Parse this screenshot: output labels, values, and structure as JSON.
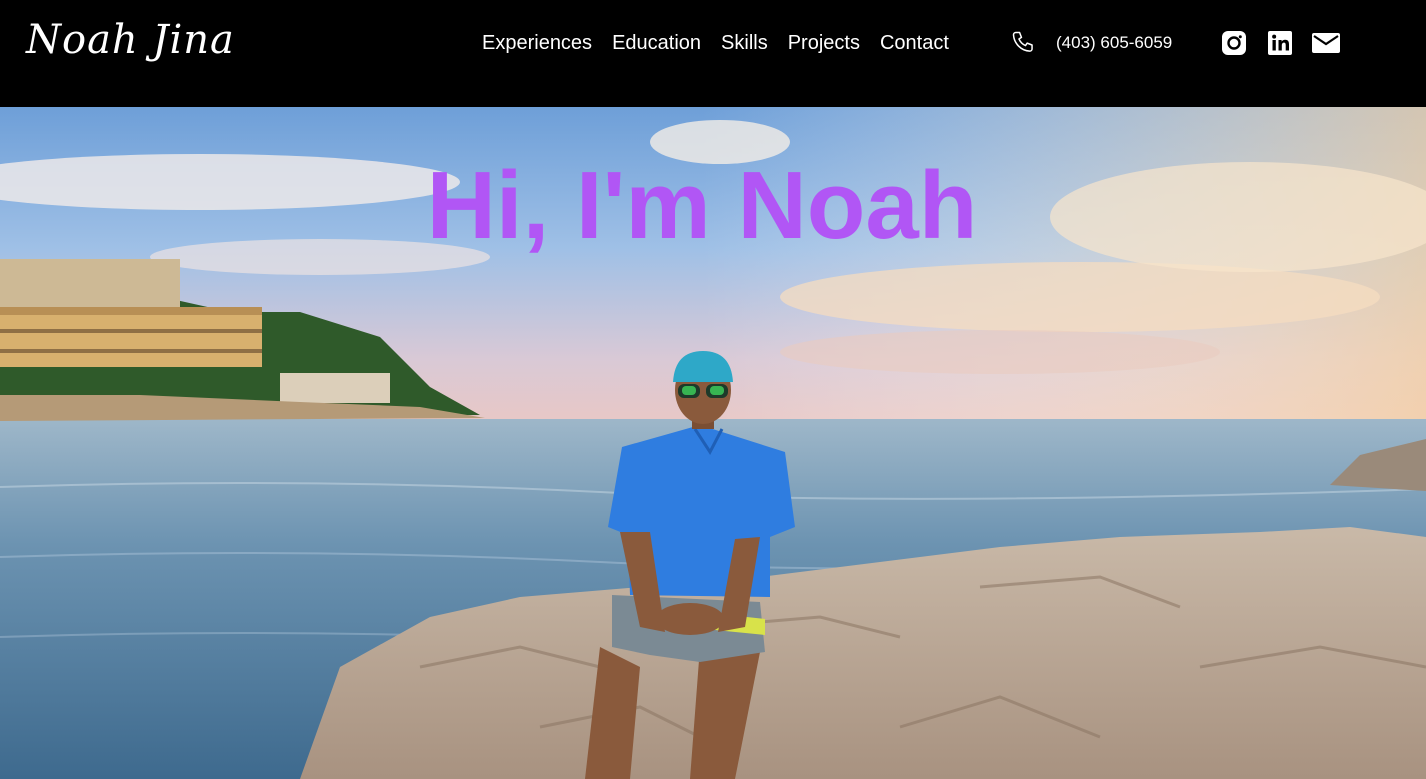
{
  "header": {
    "logo_text": "Noah Jina",
    "nav": [
      {
        "label": "Experiences"
      },
      {
        "label": "Education"
      },
      {
        "label": "Skills"
      },
      {
        "label": "Projects"
      },
      {
        "label": "Contact"
      }
    ],
    "phone": "(403) 605-6059",
    "icons": {
      "phone": "phone-icon",
      "instagram": "instagram-icon",
      "linkedin": "linkedin-icon",
      "mail": "mail-icon"
    }
  },
  "hero": {
    "title": "Hi, I'm Noah",
    "title_color": "#b156f5",
    "image": "photo of person in blue shirt and cap sitting on seaside rocks at sunset"
  }
}
